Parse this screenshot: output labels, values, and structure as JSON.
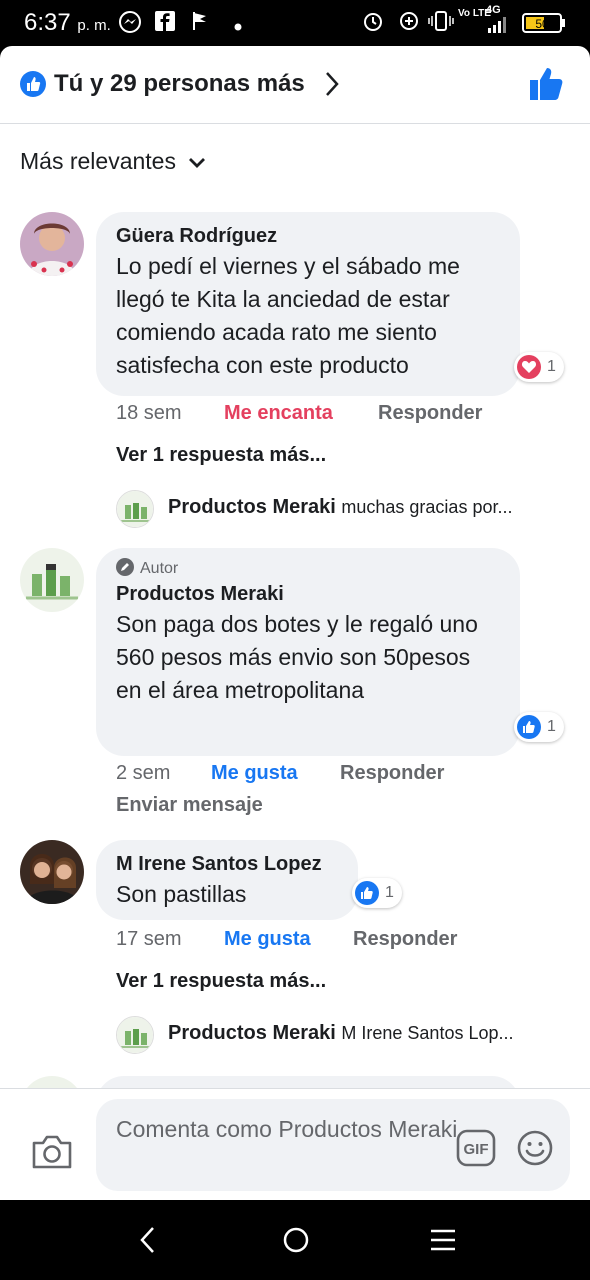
{
  "status_bar": {
    "time": "6:37",
    "ampm": "p. m.",
    "net_volte": "Vo LTE",
    "net_4g": "4G",
    "battery": "50"
  },
  "reactions_header": {
    "title": "Tú y 29 personas más"
  },
  "sort": {
    "label": "Más relevantes"
  },
  "comments": [
    {
      "name": "Güera Rodríguez",
      "text": "Lo pedí el viernes y el sábado me llegó te Kita la anciedad de estar comiendo acada rato me siento satisfecha con este producto",
      "reaction_count": "1",
      "time": "18 sem",
      "react_label": "Me encanta",
      "reply_label": "Responder",
      "more_replies": "Ver 1 respuesta más...",
      "reply_preview": {
        "name": "Productos Meraki",
        "snippet": "muchas gracias por..."
      }
    },
    {
      "badge": "Autor",
      "name": "Productos Meraki",
      "text": "Son paga dos botes y le regaló uno 560 pesos más envio son 50pesos en el área metropolitana",
      "reaction_count": "1",
      "time": "2 sem",
      "react_label": "Me gusta",
      "reply_label": "Responder",
      "extra_action": "Enviar mensaje"
    },
    {
      "name": "M Irene Santos Lopez",
      "text": "Son pastillas",
      "reaction_count": "1",
      "time": "17 sem",
      "react_label": "Me gusta",
      "reply_label": "Responder",
      "more_replies": "Ver 1 respuesta más...",
      "reply_preview": {
        "name": "Productos Meraki",
        "snippet": "M Irene Santos Lop..."
      }
    }
  ],
  "composer": {
    "placeholder": "Comenta como Productos Meraki",
    "gif_label": "GIF"
  },
  "colors": {
    "facebook_blue": "#1877f2",
    "love_red": "#e4405f",
    "bubble_gray": "#f0f2f5",
    "meta_gray": "#65676b"
  }
}
